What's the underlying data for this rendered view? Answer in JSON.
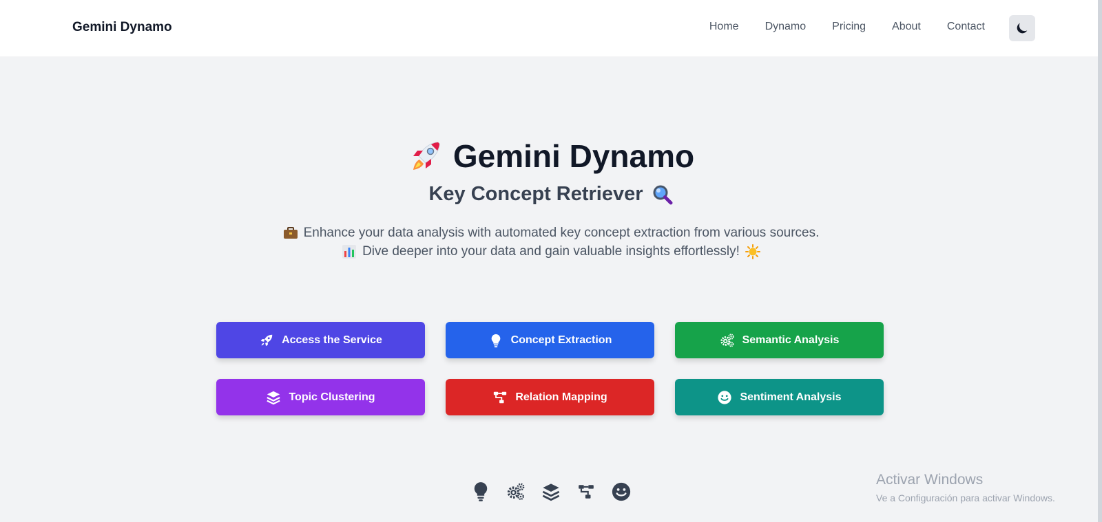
{
  "nav": {
    "brand": "Gemini Dynamo",
    "links": [
      "Home",
      "Dynamo",
      "Pricing",
      "About",
      "Contact"
    ],
    "theme_toggle_icon": "moon-icon"
  },
  "hero": {
    "title": "Gemini Dynamo",
    "title_icon": "rocket-emoji",
    "subtitle": "Key Concept Retriever",
    "subtitle_icon": "magnifier-emoji",
    "desc_line1": "Enhance your data analysis with automated key concept extraction from various sources.",
    "desc_line1_icon": "briefcase-emoji",
    "desc_line2": "Dive deeper into your data and gain valuable insights effortlessly!",
    "desc_line2_icon": "bar-chart-emoji",
    "desc_line2_trailing_icon": "sun-emoji"
  },
  "buttons": [
    {
      "label": "Access the Service",
      "icon": "rocket-icon",
      "color": "#4f46e5"
    },
    {
      "label": "Concept Extraction",
      "icon": "lightbulb-icon",
      "color": "#2563eb"
    },
    {
      "label": "Semantic Analysis",
      "icon": "gears-icon",
      "color": "#16a34a"
    },
    {
      "label": "Topic Clustering",
      "icon": "layers-icon",
      "color": "#9333ea"
    },
    {
      "label": "Relation Mapping",
      "icon": "sitemap-icon",
      "color": "#dc2626"
    },
    {
      "label": "Sentiment Analysis",
      "icon": "smile-icon",
      "color": "#0d9488"
    }
  ],
  "footer_icons": [
    "lightbulb-icon",
    "gears-icon",
    "layers-icon",
    "sitemap-icon",
    "smile-icon"
  ],
  "watermark": {
    "title": "Activar Windows",
    "subtitle": "Ve a Configuración para activar Windows."
  }
}
